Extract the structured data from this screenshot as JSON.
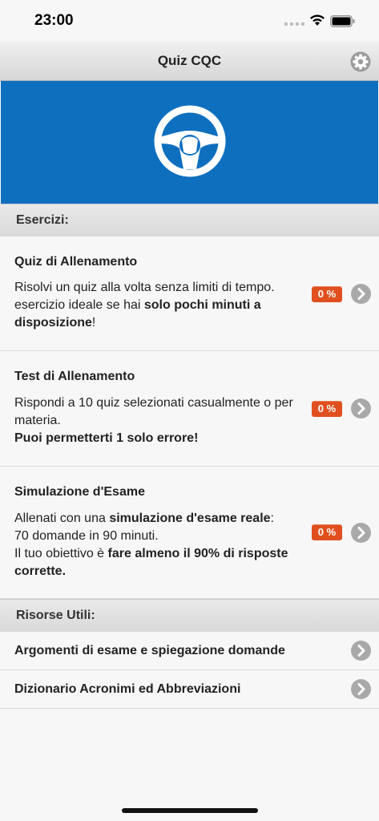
{
  "status_bar": {
    "time": "23:00"
  },
  "nav": {
    "title": "Quiz CQC"
  },
  "sections": {
    "exercises_header": "Esercizi:",
    "resources_header": "Risorse Utili:"
  },
  "exercises": [
    {
      "title": "Quiz di Allenamento",
      "line1": "Risolvi un quiz alla volta senza limiti di tempo.",
      "line2_plain": "esercizio ideale se hai ",
      "line2_bold": "solo pochi minuti a disposizione",
      "line2_end": "!",
      "progress": "0 %"
    },
    {
      "title": "Test di Allenamento",
      "line1": "Rispondi a 10 quiz selezionati casualmente o per materia.",
      "line2_bold": "Puoi permetterti 1 solo errore!",
      "progress": "0 %"
    },
    {
      "title": "Simulazione d'Esame",
      "line1_plain": "Allenati con una ",
      "line1_bold": "simulazione d'esame reale",
      "line1_end": ":",
      "line2": "70 domande in 90 minuti.",
      "line3_plain": "Il tuo obiettivo è ",
      "line3_bold": "fare almeno il 90% di risposte corrette.",
      "progress": "0 %"
    }
  ],
  "resources": [
    {
      "label": "Argomenti di esame e spiegazione domande"
    },
    {
      "label": "Dizionario Acronimi ed Abbreviazioni"
    }
  ],
  "colors": {
    "banner": "#0f6fbf",
    "badge": "#e0501f",
    "chevron": "#a9a9a9"
  },
  "icons": [
    "gear-icon",
    "steering-wheel-icon",
    "chevron-right-icon",
    "wifi-icon",
    "battery-icon"
  ]
}
